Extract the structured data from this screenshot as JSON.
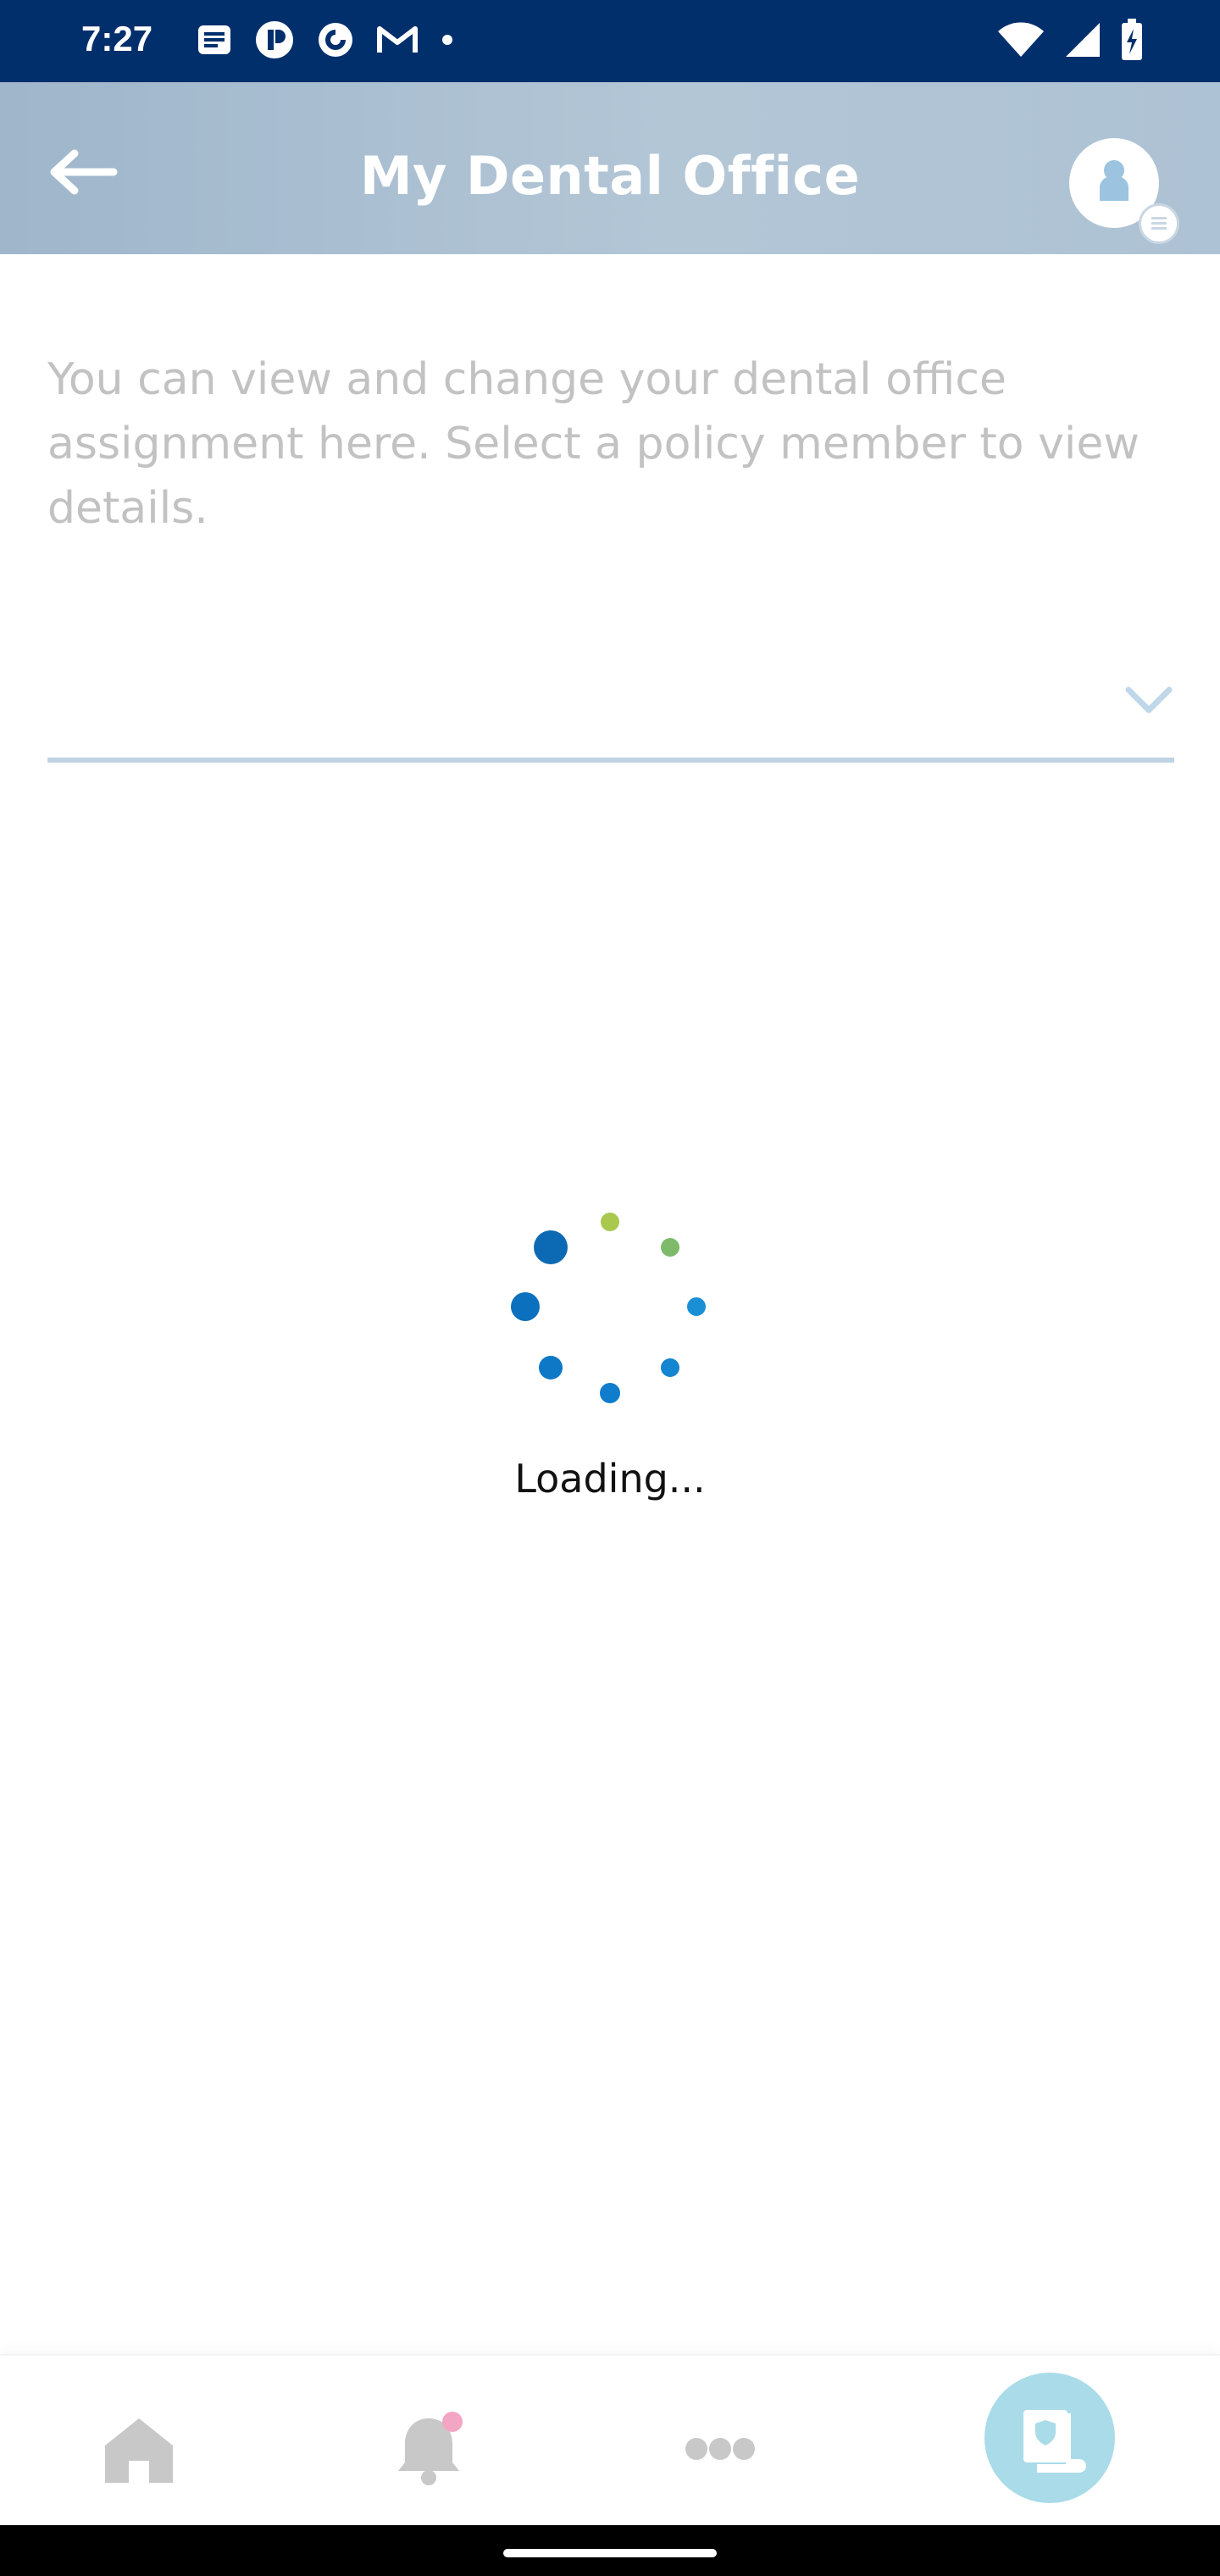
{
  "status_bar": {
    "time": "7:27",
    "left_icons": [
      "news-icon",
      "app-icon",
      "pocket-casts-icon",
      "gmail-icon",
      "dot-icon"
    ],
    "right_icons": [
      "wifi-icon",
      "signal-icon",
      "battery-icon"
    ]
  },
  "header": {
    "title": "My Dental Office",
    "back_icon": "arrow-left-icon",
    "profile_icon": "user-icon"
  },
  "content": {
    "description": "You can view and change your dental office assignment here. Select a policy member to view details.",
    "member_select_value": "",
    "member_select_icon": "chevron-down-icon"
  },
  "loading": {
    "text": "Loading..."
  },
  "bottom_nav": {
    "items": [
      {
        "icon": "home-icon",
        "active": false
      },
      {
        "icon": "bell-icon",
        "active": false,
        "badge": true
      },
      {
        "icon": "more-icon",
        "active": false
      },
      {
        "icon": "dental-card-icon",
        "active": true
      }
    ]
  },
  "colors": {
    "status_bar": "#002f6c",
    "header": "#b3c6d6",
    "description_text": "#c2c2c2",
    "select_underline": "#bfd3e3",
    "spinner_blue": "#0b6ab3",
    "spinner_green": "#a8c94d",
    "nav_active": "#a9dbe8",
    "notification_badge": "#f3a6c3"
  }
}
